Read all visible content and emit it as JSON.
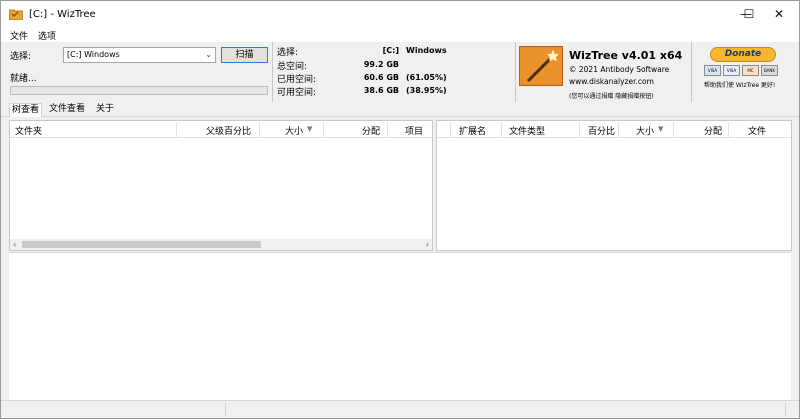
{
  "window": {
    "title": "[C:]  - WizTree",
    "minimize": "—",
    "maximize": "☐",
    "close": "✕"
  },
  "menu": {
    "file": "文件",
    "options": "选项"
  },
  "scan": {
    "select_label": "选择:",
    "drive_value": "[C:] Windows",
    "scan_button": "扫描",
    "status": "就绪..."
  },
  "stats": {
    "select_label": "选择:",
    "drive": "[C:]",
    "drive_name": "Windows",
    "total_label": "总空间:",
    "total_value": "99.2 GB",
    "used_label": "已用空间:",
    "used_value": "60.6 GB",
    "used_pct": "(61.05%)",
    "free_label": "可用空间:",
    "free_value": "38.6 GB",
    "free_pct": "(38.95%)"
  },
  "brand": {
    "title": "WizTree v4.01 x64",
    "copyright": "© 2021 Antibody Software",
    "site": "www.diskanalyzer.com",
    "footer": "(您可以通过捐赠 隐藏捐赠按钮)"
  },
  "donate": {
    "button": "Donate",
    "cards": [
      "VISA",
      "VISA",
      "MC",
      "BANK"
    ],
    "footer": "帮助我们使 WizTree 更好!"
  },
  "tabs": [
    "树查看",
    "文件查看",
    "关于"
  ],
  "tree_columns": {
    "folder": "文件夹",
    "parent_pct": "父级百分比",
    "size": "大小",
    "alloc": "分配",
    "items": "项目"
  },
  "file_columns": {
    "ext": "扩展名",
    "type": "文件类型",
    "pct": "百分比",
    "size": "大小",
    "alloc": "分配",
    "files": "文件"
  },
  "colors": {
    "accent": "#2c7bd4",
    "donate": "#f6b62f",
    "logo": "#e9912a"
  }
}
